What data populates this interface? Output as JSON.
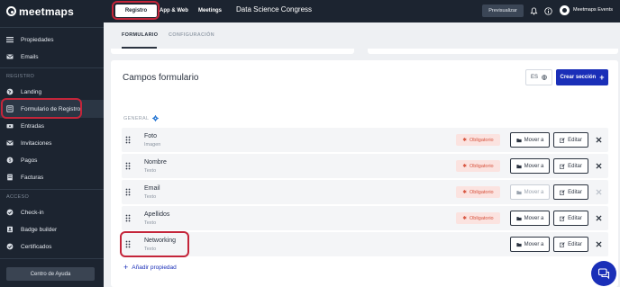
{
  "app": {
    "brand": "meetmaps"
  },
  "sidebar": {
    "items_top": [
      {
        "label": "Propiedades",
        "icon": "list-icon"
      },
      {
        "label": "Emails",
        "icon": "mail-icon"
      }
    ],
    "group_registro": "REGISTRO",
    "items_registro": [
      {
        "label": "Landing",
        "icon": "globe-icon"
      },
      {
        "label": "Formulario de Registro",
        "icon": "form-icon"
      },
      {
        "label": "Entradas",
        "icon": "ticket-icon"
      },
      {
        "label": "Invitaciones",
        "icon": "envelope-icon"
      },
      {
        "label": "Pagos",
        "icon": "payment-icon"
      },
      {
        "label": "Facturas",
        "icon": "invoice-icon"
      }
    ],
    "group_acceso": "ACCESO",
    "items_acceso": [
      {
        "label": "Check-in",
        "icon": "check-icon"
      },
      {
        "label": "Badge builder",
        "icon": "badge-icon"
      },
      {
        "label": "Certificados",
        "icon": "certificate-icon"
      }
    ],
    "help_label": "Centro de Ayuda"
  },
  "topbar": {
    "tabs": [
      "Registro",
      "App & Web",
      "Meetings"
    ],
    "event_name": "Data Science Congress",
    "preview_label": "Previsualizar",
    "user_name": "Meetmaps Events"
  },
  "subtabs": [
    "FORMULARIO",
    "CONFIGURACIÓN"
  ],
  "form": {
    "title": "Campos formulario",
    "lang": "ES",
    "create_section_label": "Crear sección",
    "group_label": "GENERAL",
    "required_label": "Obligatorio",
    "move_label": "Mover a",
    "edit_label": "Editar",
    "add_property_label": "Añadir propiedad",
    "fields": [
      {
        "name": "Foto",
        "type": "Imagen"
      },
      {
        "name": "Nombre",
        "type": "Texto"
      },
      {
        "name": "Email",
        "type": "Texto"
      },
      {
        "name": "Apellidos",
        "type": "Texto"
      },
      {
        "name": "Networking",
        "type": "Texto"
      }
    ]
  },
  "colors": {
    "accent": "#1a2fb8",
    "sidebar": "#1c2430",
    "required": "#d7533d",
    "annotation": "#c4253a"
  }
}
